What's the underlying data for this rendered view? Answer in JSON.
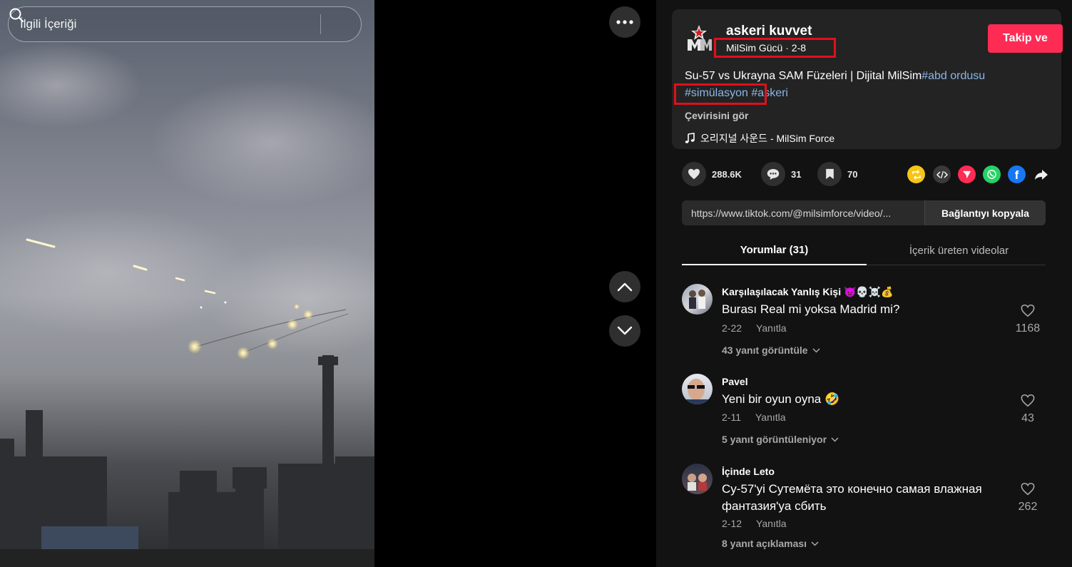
{
  "search": {
    "placeholder": "İlgili İçeriği"
  },
  "author": {
    "name": "askeri kuvvet",
    "subtitle": "MilSim Gücü · 2-8",
    "follow_label": "Takip ve"
  },
  "caption": {
    "text": "Su-57 vs Ukrayna SAM Füzeleri | Dijital MilSim",
    "tags": [
      "#abd ordusu",
      "#simülasyon",
      "#askeri"
    ],
    "translate_label": "Çevirisini gör"
  },
  "music": {
    "label": "오리지널 사운드 - MilSim Force"
  },
  "stats": {
    "likes": "288.6K",
    "comments": "31",
    "saves": "70"
  },
  "share_icons": [
    "repost-icon",
    "embed-icon",
    "send-icon",
    "whatsapp-icon",
    "facebook-icon",
    "share-arrow-icon"
  ],
  "colors": {
    "accent": "#fe2c55",
    "tag": "#8bb6e8",
    "highlight": "#e0101c"
  },
  "link": {
    "url": "https://www.tiktok.com/@milsimforce/video/...",
    "copy_label": "Bağlantıyı kopyala"
  },
  "tabs": [
    {
      "label": "Yorumlar (31)",
      "active": true
    },
    {
      "label": "İçerik üreten videolar",
      "active": false
    }
  ],
  "comments": [
    {
      "author": "Karşılaşılacak Yanlış Kişi 👿💀☠️💰",
      "text": "Burası Real mi yoksa Madrid mi?",
      "date": "2-22",
      "reply_label": "Yanıtla",
      "likes": "1168",
      "more_label": "43 yanıt görüntüle"
    },
    {
      "author": "Pavel",
      "text": "Yeni bir oyun oyna 🤣",
      "date": "2-11",
      "reply_label": "Yanıtla",
      "likes": "43",
      "more_label": "5 yanıt görüntüleniyor"
    },
    {
      "author": "İçinde Leto",
      "text": "Су-57'yi Сутемёта это конечно самая влажная фантазия'ya сбить",
      "date": "2-12",
      "reply_label": "Yanıtla",
      "likes": "262",
      "more_label": "8 yanıt açıklaması"
    }
  ]
}
